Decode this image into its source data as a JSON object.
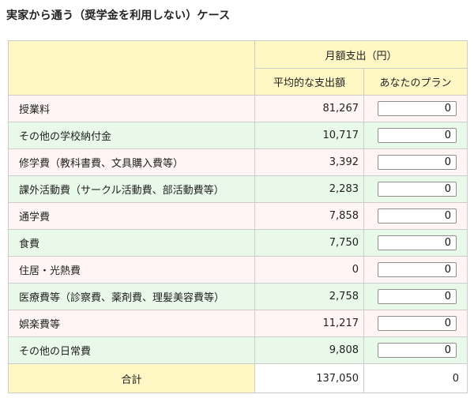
{
  "title": "実家から通う（奨学金を利用しない）ケース",
  "table": {
    "group_header": "月額支出（円）",
    "col_average": "平均的な支出額",
    "col_plan": "あなたのプラン",
    "rows": [
      {
        "label": "授業料",
        "average": "81,267",
        "plan": "0"
      },
      {
        "label": "その他の学校納付金",
        "average": "10,717",
        "plan": "0"
      },
      {
        "label": "修学費（教科書費、文具購入費等）",
        "average": "3,392",
        "plan": "0"
      },
      {
        "label": "課外活動費（サークル活動費、部活動費等）",
        "average": "2,283",
        "plan": "0"
      },
      {
        "label": "通学費",
        "average": "7,858",
        "plan": "0"
      },
      {
        "label": "食費",
        "average": "7,750",
        "plan": "0"
      },
      {
        "label": "住居・光熱費",
        "average": "0",
        "plan": "0"
      },
      {
        "label": "医療費等（診察費、薬剤費、理髪美容費等）",
        "average": "2,758",
        "plan": "0"
      },
      {
        "label": "娯楽費等",
        "average": "11,217",
        "plan": "0"
      },
      {
        "label": "その他の日常費",
        "average": "9,808",
        "plan": "0"
      }
    ],
    "total": {
      "label": "合計",
      "average": "137,050",
      "plan": "0"
    }
  },
  "colors": {
    "header_bg": "#fff8c4",
    "row_pink": "#fff5f5",
    "row_green": "#e9f9e9",
    "border": "#cccccc"
  }
}
